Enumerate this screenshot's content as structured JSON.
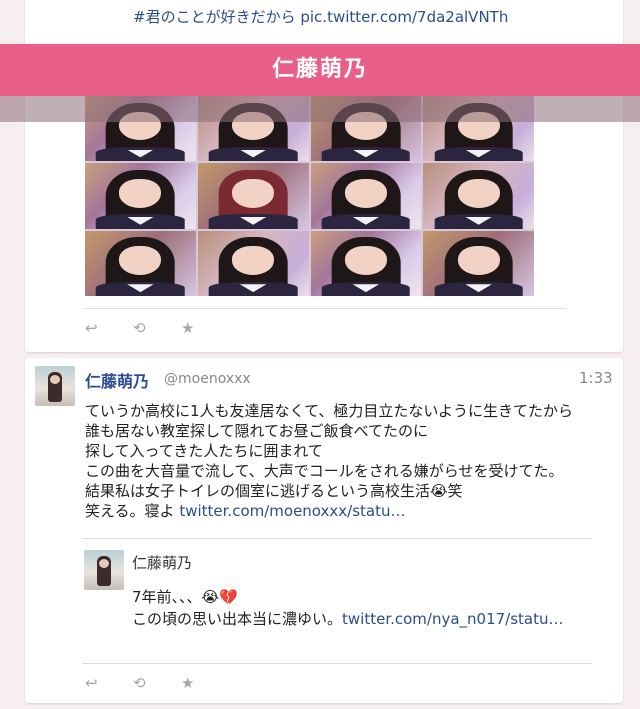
{
  "top_tweet": {
    "hashtag_text": "#君のことが好きだから",
    "pic_link": "pic.twitter.com/7da2alVNTh",
    "banner_title": "仁藤萌乃"
  },
  "tweet": {
    "display_name": "仁藤萌乃",
    "handle": "@moenoxxx",
    "time": "1:33",
    "body": "ていうか高校に1人も友達居なくて、極力目立たないように生きてたから\n誰も居ない教室探して隠れてお昼ご飯食べてたのに\n探して入ってきた人たちに囲まれて\nこの曲を大音量で流して、大声でコールをされる嫌がらせを受けてた。\n結果私は女子トイレの個室に逃げるという高校生活😭笑\n笑える。寝よ ",
    "link": "twitter.com/moenoxxx/statu…",
    "quote": {
      "display_name": "仁藤萌乃",
      "body": "7年前、、、😭💔\nこの頃の思い出本当に濃ゆい。",
      "link": "twitter.com/nya_n017/statu…"
    }
  },
  "actions": {
    "reply": "↩",
    "retweet": "⟲",
    "favorite": "★"
  }
}
